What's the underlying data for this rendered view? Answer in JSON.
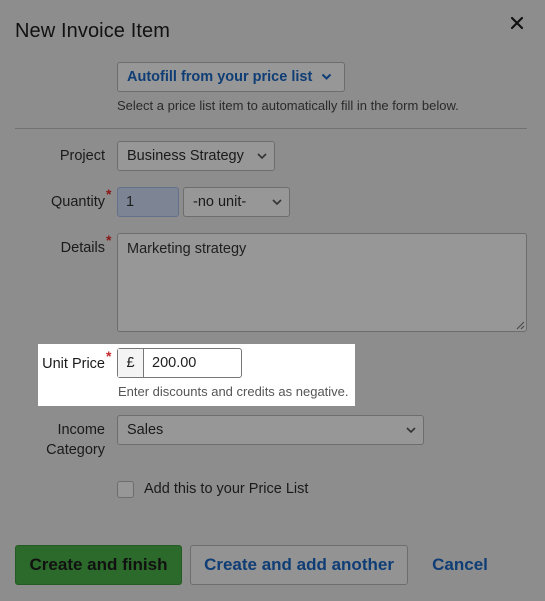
{
  "dialog": {
    "title": "New Invoice Item",
    "close_icon": "close-icon"
  },
  "autofill": {
    "button_label": "Autofill from your price list",
    "helper": "Select a price list item to automatically fill in the form below."
  },
  "form": {
    "project": {
      "label": "Project",
      "value": "Business Strategy"
    },
    "quantity": {
      "label": "Quantity",
      "required": "*",
      "value": "1",
      "unit_value": "-no unit-"
    },
    "details": {
      "label": "Details",
      "required": "*",
      "value": "Marketing strategy"
    },
    "unit_price": {
      "label": "Unit Price",
      "required": "*",
      "currency": "£",
      "value": "200.00",
      "helper": "Enter discounts and credits as negative."
    },
    "income_category": {
      "label_line1": "Income",
      "label_line2": "Category",
      "value": "Sales"
    },
    "price_list_checkbox": {
      "label": "Add this to your Price List",
      "checked": false
    }
  },
  "actions": {
    "primary": "Create and finish",
    "secondary": "Create and add another",
    "cancel": "Cancel"
  },
  "colors": {
    "overlay": "#8d8d8d",
    "link": "#0f3d75",
    "primary": "#2b6a2b",
    "required": "#8a1717"
  }
}
